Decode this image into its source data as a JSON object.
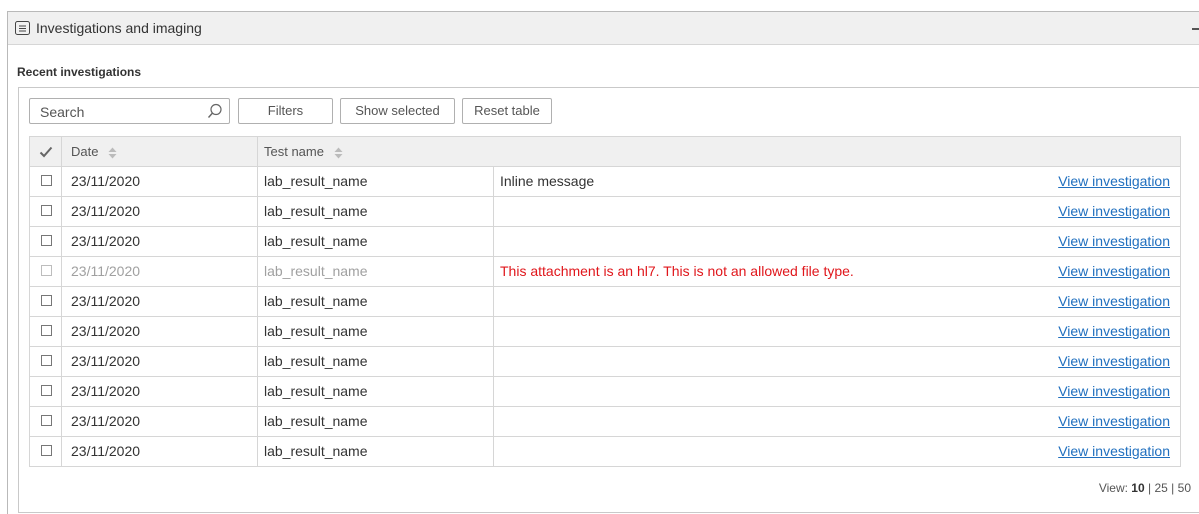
{
  "panel": {
    "title": "Investigations and imaging",
    "section_title": "Recent investigations"
  },
  "toolbar": {
    "search_placeholder": "Search",
    "filters_label": "Filters",
    "show_selected_label": "Show selected",
    "reset_table_label": "Reset table"
  },
  "table": {
    "columns": {
      "date": "Date",
      "test_name": "Test name"
    },
    "rows": [
      {
        "date": "23/11/2020",
        "test": "lab_result_name",
        "message": "Inline message",
        "link": "View investigation",
        "disabled": false
      },
      {
        "date": "23/11/2020",
        "test": "lab_result_name",
        "message": "",
        "link": "View investigation",
        "disabled": false
      },
      {
        "date": "23/11/2020",
        "test": "lab_result_name",
        "message": "",
        "link": "View investigation",
        "disabled": false
      },
      {
        "date": "23/11/2020",
        "test": "lab_result_name",
        "message": "This attachment is an hl7. This is not an allowed file type.",
        "link": "View investigation",
        "disabled": true
      },
      {
        "date": "23/11/2020",
        "test": "lab_result_name",
        "message": "",
        "link": "View investigation",
        "disabled": false
      },
      {
        "date": "23/11/2020",
        "test": "lab_result_name",
        "message": "",
        "link": "View investigation",
        "disabled": false
      },
      {
        "date": "23/11/2020",
        "test": "lab_result_name",
        "message": "",
        "link": "View investigation",
        "disabled": false
      },
      {
        "date": "23/11/2020",
        "test": "lab_result_name",
        "message": "",
        "link": "View investigation",
        "disabled": false
      },
      {
        "date": "23/11/2020",
        "test": "lab_result_name",
        "message": "",
        "link": "View investigation",
        "disabled": false
      },
      {
        "date": "23/11/2020",
        "test": "lab_result_name",
        "message": "",
        "link": "View investigation",
        "disabled": false
      }
    ]
  },
  "pager": {
    "label": "View:",
    "current": "10",
    "sep1": "|",
    "option_25": "25",
    "sep2": "|",
    "option_50": "50"
  },
  "colors": {
    "link": "#1f6fbf",
    "error": "#e0161b",
    "header_bg": "#f0f0f0"
  }
}
